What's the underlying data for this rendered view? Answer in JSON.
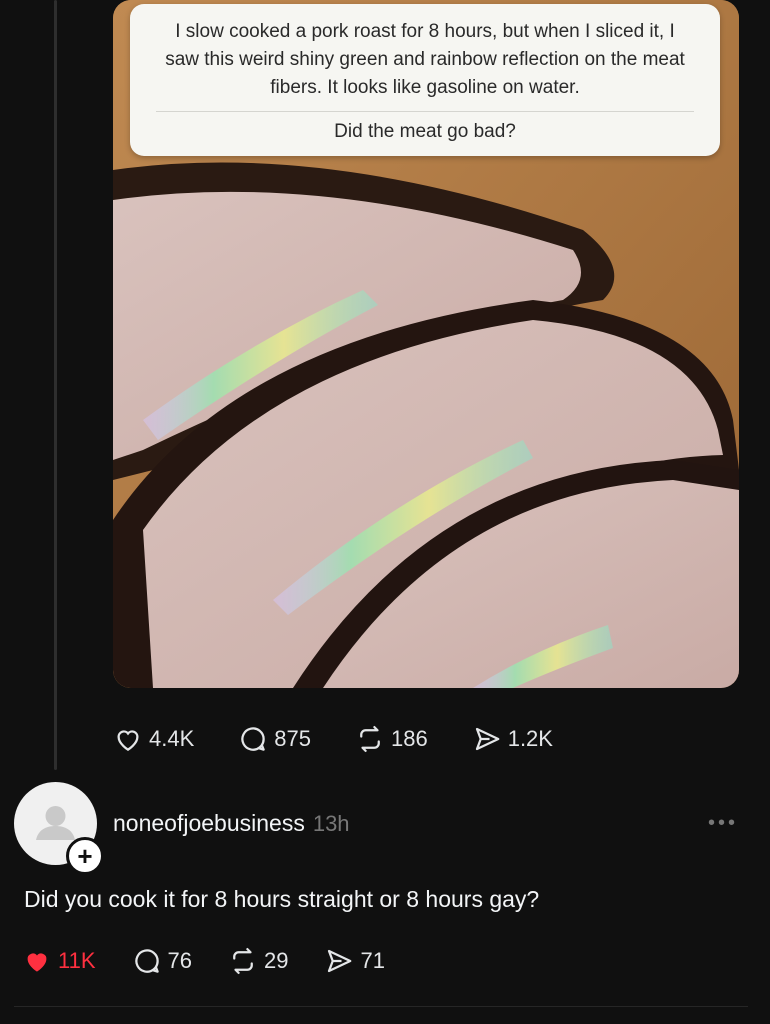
{
  "post": {
    "media": {
      "caption_question": "I slow cooked a pork roast for 8 hours, but when I sliced it, I saw this weird shiny green and rainbow reflection on the meat fibers. It looks like gasoline on water.",
      "caption_followup": "Did the meat go bad?"
    },
    "actions": {
      "likes": "4.4K",
      "replies": "875",
      "reposts": "186",
      "shares": "1.2K"
    }
  },
  "reply": {
    "username": "noneofjoebusiness",
    "time": "13h",
    "more_label": "•••",
    "follow_label": "+",
    "text": "Did you cook it for 8 hours straight or 8 hours gay?",
    "actions": {
      "likes": "11K",
      "replies": "76",
      "reposts": "29",
      "shares": "71"
    },
    "liked": true
  },
  "colors": {
    "background": "#101010",
    "like_active": "#ff3040",
    "muted": "#777777"
  }
}
